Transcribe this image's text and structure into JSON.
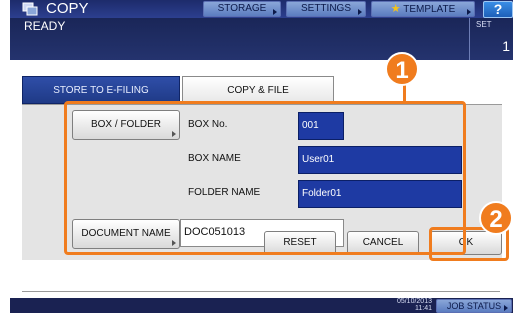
{
  "header": {
    "app_title": "COPY",
    "app_icon": "copy-icon",
    "storage_label": "STORAGE",
    "settings_label": "SETTINGS",
    "template_label": "TEMPLATE",
    "help_label": "?"
  },
  "status": {
    "text": "READY",
    "set_label": "SET",
    "set_value": "1"
  },
  "tabs": [
    {
      "label": "STORE TO E-FILING"
    },
    {
      "label": "COPY & FILE"
    }
  ],
  "form": {
    "box_folder_button": "BOX / FOLDER",
    "box_no_label": "BOX No.",
    "box_no_value": "001",
    "box_name_label": "BOX NAME",
    "box_name_value": "User01",
    "folder_name_label": "FOLDER NAME",
    "folder_name_value": "Folder01",
    "document_name_button": "DOCUMENT NAME",
    "document_name_value": "DOC051013"
  },
  "actions": {
    "reset": "RESET",
    "cancel": "CANCEL",
    "ok": "OK"
  },
  "footer": {
    "date": "05/10/2013",
    "time": "11:41",
    "job_status": "JOB STATUS"
  },
  "callouts": {
    "first": "1",
    "second": "2"
  },
  "colors": {
    "accent": "#f07c1e",
    "header": "#1d2b6b",
    "field": "#1e3aa3"
  }
}
